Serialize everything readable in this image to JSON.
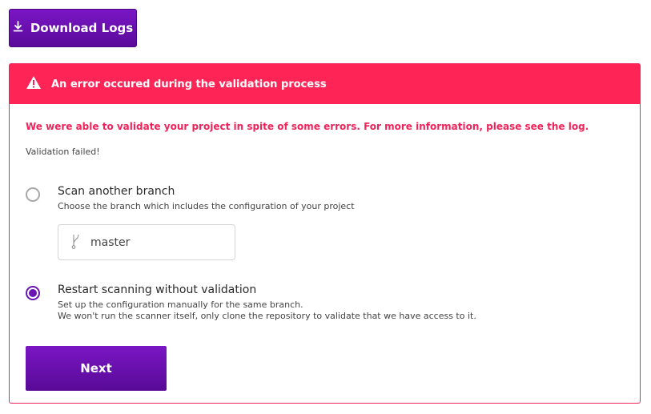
{
  "toolbar": {
    "download_label": "Download Logs",
    "download_icon": "download-icon"
  },
  "alert": {
    "title": "An error occured during the validation process",
    "icon": "warning-icon",
    "color": "#ff2456",
    "message": "We were able to validate your project in spite of some errors. For more information, please see the log.",
    "status": "Validation failed!"
  },
  "options": [
    {
      "title": "Scan another branch",
      "description": "Choose the branch which includes the configuration of your project",
      "selected": false
    },
    {
      "title": "Restart scanning without validation",
      "description_line1": "Set up the configuration manually for the same branch.",
      "description_line2": "We won't run the scanner itself, only clone the repository to validate that we have access to it.",
      "selected": true
    }
  ],
  "branch": {
    "value": "master",
    "icon": "git-branch-icon"
  },
  "actions": {
    "next_label": "Next"
  },
  "colors": {
    "accent": "#6b15b5",
    "error": "#ff2456"
  }
}
